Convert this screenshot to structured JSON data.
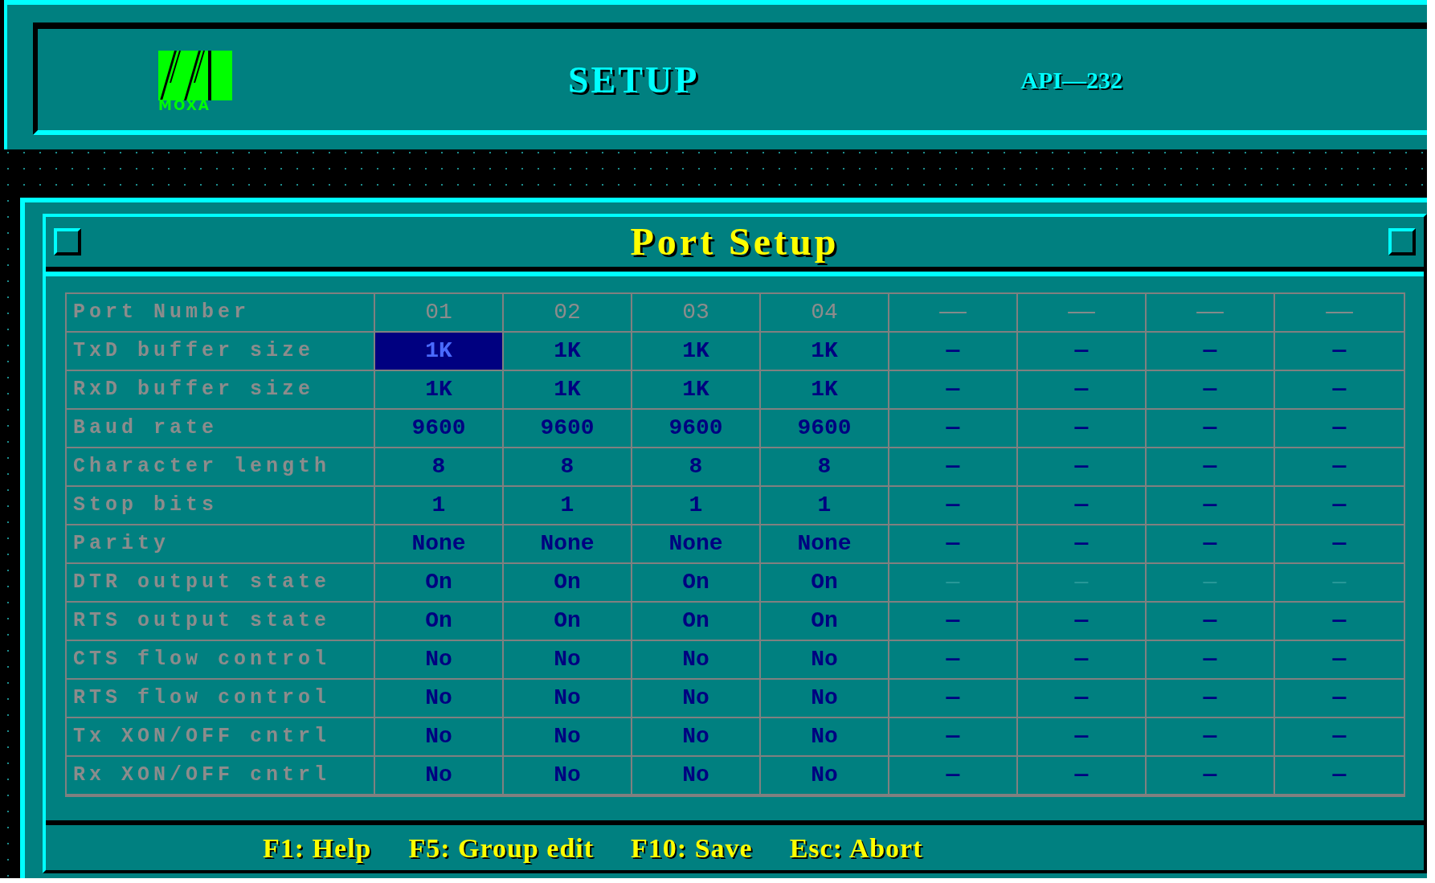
{
  "header": {
    "logo_text": "MOXA",
    "title": "SETUP",
    "model": "API—232"
  },
  "window": {
    "title": "Port Setup"
  },
  "table": {
    "rows": [
      {
        "label": "Port Number",
        "kind": "header",
        "dimmed": false,
        "cells": [
          {
            "text": "01",
            "kind": "value",
            "selected": false
          },
          {
            "text": "02",
            "kind": "value",
            "selected": false
          },
          {
            "text": "03",
            "kind": "value",
            "selected": false
          },
          {
            "text": "04",
            "kind": "value",
            "selected": false
          },
          {
            "text": "——",
            "kind": "empty",
            "selected": false
          },
          {
            "text": "——",
            "kind": "empty",
            "selected": false
          },
          {
            "text": "——",
            "kind": "empty",
            "selected": false
          },
          {
            "text": "——",
            "kind": "empty",
            "selected": false
          }
        ]
      },
      {
        "label": "TxD buffer size",
        "kind": "data",
        "dimmed": false,
        "cells": [
          {
            "text": "1K",
            "kind": "value",
            "selected": true
          },
          {
            "text": "1K",
            "kind": "value",
            "selected": false
          },
          {
            "text": "1K",
            "kind": "value",
            "selected": false
          },
          {
            "text": "1K",
            "kind": "value",
            "selected": false
          },
          {
            "text": "—",
            "kind": "empty",
            "selected": false
          },
          {
            "text": "—",
            "kind": "empty",
            "selected": false
          },
          {
            "text": "—",
            "kind": "empty",
            "selected": false
          },
          {
            "text": "—",
            "kind": "empty",
            "selected": false
          }
        ]
      },
      {
        "label": "RxD buffer size",
        "kind": "data",
        "dimmed": false,
        "cells": [
          {
            "text": "1K",
            "kind": "value",
            "selected": false
          },
          {
            "text": "1K",
            "kind": "value",
            "selected": false
          },
          {
            "text": "1K",
            "kind": "value",
            "selected": false
          },
          {
            "text": "1K",
            "kind": "value",
            "selected": false
          },
          {
            "text": "—",
            "kind": "empty",
            "selected": false
          },
          {
            "text": "—",
            "kind": "empty",
            "selected": false
          },
          {
            "text": "—",
            "kind": "empty",
            "selected": false
          },
          {
            "text": "—",
            "kind": "empty",
            "selected": false
          }
        ]
      },
      {
        "label": "Baud rate",
        "kind": "data",
        "dimmed": false,
        "cells": [
          {
            "text": "9600",
            "kind": "value",
            "selected": false
          },
          {
            "text": "9600",
            "kind": "value",
            "selected": false
          },
          {
            "text": "9600",
            "kind": "value",
            "selected": false
          },
          {
            "text": "9600",
            "kind": "value",
            "selected": false
          },
          {
            "text": "—",
            "kind": "empty",
            "selected": false
          },
          {
            "text": "—",
            "kind": "empty",
            "selected": false
          },
          {
            "text": "—",
            "kind": "empty",
            "selected": false
          },
          {
            "text": "—",
            "kind": "empty",
            "selected": false
          }
        ]
      },
      {
        "label": "Character length",
        "kind": "data",
        "dimmed": false,
        "cells": [
          {
            "text": "8",
            "kind": "value",
            "selected": false
          },
          {
            "text": "8",
            "kind": "value",
            "selected": false
          },
          {
            "text": "8",
            "kind": "value",
            "selected": false
          },
          {
            "text": "8",
            "kind": "value",
            "selected": false
          },
          {
            "text": "—",
            "kind": "empty",
            "selected": false
          },
          {
            "text": "—",
            "kind": "empty",
            "selected": false
          },
          {
            "text": "—",
            "kind": "empty",
            "selected": false
          },
          {
            "text": "—",
            "kind": "empty",
            "selected": false
          }
        ]
      },
      {
        "label": "Stop bits",
        "kind": "data",
        "dimmed": false,
        "cells": [
          {
            "text": "1",
            "kind": "value",
            "selected": false
          },
          {
            "text": "1",
            "kind": "value",
            "selected": false
          },
          {
            "text": "1",
            "kind": "value",
            "selected": false
          },
          {
            "text": "1",
            "kind": "value",
            "selected": false
          },
          {
            "text": "—",
            "kind": "empty",
            "selected": false
          },
          {
            "text": "—",
            "kind": "empty",
            "selected": false
          },
          {
            "text": "—",
            "kind": "empty",
            "selected": false
          },
          {
            "text": "—",
            "kind": "empty",
            "selected": false
          }
        ]
      },
      {
        "label": "Parity",
        "kind": "data",
        "dimmed": false,
        "cells": [
          {
            "text": "None",
            "kind": "value",
            "selected": false
          },
          {
            "text": "None",
            "kind": "value",
            "selected": false
          },
          {
            "text": "None",
            "kind": "value",
            "selected": false
          },
          {
            "text": "None",
            "kind": "value",
            "selected": false
          },
          {
            "text": "—",
            "kind": "empty",
            "selected": false
          },
          {
            "text": "—",
            "kind": "empty",
            "selected": false
          },
          {
            "text": "—",
            "kind": "empty",
            "selected": false
          },
          {
            "text": "—",
            "kind": "empty",
            "selected": false
          }
        ]
      },
      {
        "label": "DTR output state",
        "kind": "data",
        "dimmed": true,
        "cells": [
          {
            "text": "On",
            "kind": "value",
            "selected": false
          },
          {
            "text": "On",
            "kind": "value",
            "selected": false
          },
          {
            "text": "On",
            "kind": "value",
            "selected": false
          },
          {
            "text": "On",
            "kind": "value",
            "selected": false
          },
          {
            "text": "—",
            "kind": "empty",
            "selected": false
          },
          {
            "text": "—",
            "kind": "empty",
            "selected": false
          },
          {
            "text": "—",
            "kind": "empty",
            "selected": false
          },
          {
            "text": "—",
            "kind": "empty",
            "selected": false
          }
        ]
      },
      {
        "label": "RTS output state",
        "kind": "data",
        "dimmed": false,
        "cells": [
          {
            "text": "On",
            "kind": "value",
            "selected": false
          },
          {
            "text": "On",
            "kind": "value",
            "selected": false
          },
          {
            "text": "On",
            "kind": "value",
            "selected": false
          },
          {
            "text": "On",
            "kind": "value",
            "selected": false
          },
          {
            "text": "—",
            "kind": "empty",
            "selected": false
          },
          {
            "text": "—",
            "kind": "empty",
            "selected": false
          },
          {
            "text": "—",
            "kind": "empty",
            "selected": false
          },
          {
            "text": "—",
            "kind": "empty",
            "selected": false
          }
        ]
      },
      {
        "label": "CTS flow control",
        "kind": "data",
        "dimmed": false,
        "cells": [
          {
            "text": "No",
            "kind": "value",
            "selected": false
          },
          {
            "text": "No",
            "kind": "value",
            "selected": false
          },
          {
            "text": "No",
            "kind": "value",
            "selected": false
          },
          {
            "text": "No",
            "kind": "value",
            "selected": false
          },
          {
            "text": "—",
            "kind": "empty",
            "selected": false
          },
          {
            "text": "—",
            "kind": "empty",
            "selected": false
          },
          {
            "text": "—",
            "kind": "empty",
            "selected": false
          },
          {
            "text": "—",
            "kind": "empty",
            "selected": false
          }
        ]
      },
      {
        "label": "RTS flow control",
        "kind": "data",
        "dimmed": false,
        "cells": [
          {
            "text": "No",
            "kind": "value",
            "selected": false
          },
          {
            "text": "No",
            "kind": "value",
            "selected": false
          },
          {
            "text": "No",
            "kind": "value",
            "selected": false
          },
          {
            "text": "No",
            "kind": "value",
            "selected": false
          },
          {
            "text": "—",
            "kind": "empty",
            "selected": false
          },
          {
            "text": "—",
            "kind": "empty",
            "selected": false
          },
          {
            "text": "—",
            "kind": "empty",
            "selected": false
          },
          {
            "text": "—",
            "kind": "empty",
            "selected": false
          }
        ]
      },
      {
        "label": "Tx XON/OFF cntrl",
        "kind": "data",
        "dimmed": false,
        "cells": [
          {
            "text": "No",
            "kind": "value",
            "selected": false
          },
          {
            "text": "No",
            "kind": "value",
            "selected": false
          },
          {
            "text": "No",
            "kind": "value",
            "selected": false
          },
          {
            "text": "No",
            "kind": "value",
            "selected": false
          },
          {
            "text": "—",
            "kind": "empty",
            "selected": false
          },
          {
            "text": "—",
            "kind": "empty",
            "selected": false
          },
          {
            "text": "—",
            "kind": "empty",
            "selected": false
          },
          {
            "text": "—",
            "kind": "empty",
            "selected": false
          }
        ]
      },
      {
        "label": "Rx XON/OFF cntrl",
        "kind": "data",
        "dimmed": false,
        "cells": [
          {
            "text": "No",
            "kind": "value",
            "selected": false
          },
          {
            "text": "No",
            "kind": "value",
            "selected": false
          },
          {
            "text": "No",
            "kind": "value",
            "selected": false
          },
          {
            "text": "No",
            "kind": "value",
            "selected": false
          },
          {
            "text": "—",
            "kind": "empty",
            "selected": false
          },
          {
            "text": "—",
            "kind": "empty",
            "selected": false
          },
          {
            "text": "—",
            "kind": "empty",
            "selected": false
          },
          {
            "text": "—",
            "kind": "empty",
            "selected": false
          }
        ]
      }
    ]
  },
  "footer": {
    "keys": [
      {
        "key": "F1:",
        "action": "Help"
      },
      {
        "key": "F5:",
        "action": "Group edit"
      },
      {
        "key": "F10:",
        "action": "Save"
      },
      {
        "key": "Esc:",
        "action": "Abort"
      }
    ]
  }
}
